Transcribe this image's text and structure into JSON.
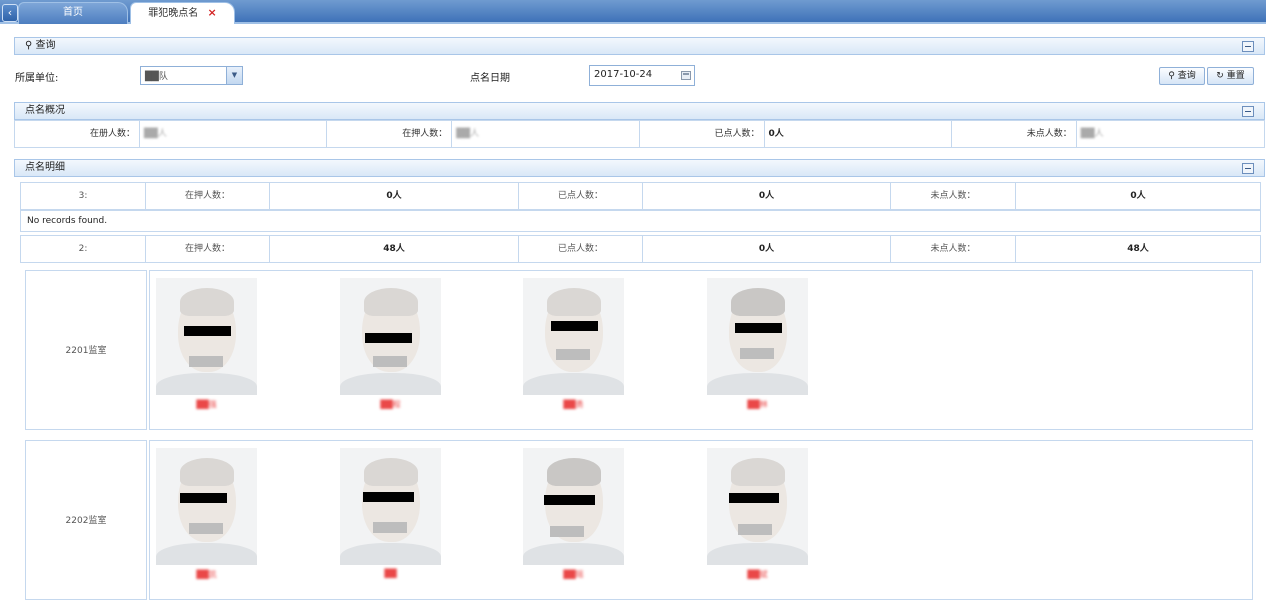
{
  "tabs": {
    "home": "首页",
    "active": "罪犯晚点名",
    "close_glyph": "×",
    "back_glyph": "‹"
  },
  "query": {
    "header": "查询",
    "unit_label": "所属单位:",
    "unit_value": "██队",
    "date_label": "点名日期",
    "date_value": "2017-10-24",
    "search_button": "查询",
    "reset_button": "重置"
  },
  "overview": {
    "header": "点名概况",
    "items": [
      {
        "label": "在册人数：",
        "value": "██人"
      },
      {
        "label": "在押人数：",
        "value": "██人"
      },
      {
        "label": "已点人数：",
        "value": "0人"
      },
      {
        "label": "未点人数：",
        "value": "██人"
      }
    ]
  },
  "detail": {
    "header": "点名明细",
    "groups": [
      {
        "id": "3:",
        "in_custody_label": "在押人数：",
        "in_custody": "0人",
        "called_label": "已点人数：",
        "called": "0人",
        "uncalled_label": "未点人数：",
        "uncalled": "0人"
      },
      {
        "id": "2:",
        "in_custody_label": "在押人数：",
        "in_custody": "48人",
        "called_label": "已点人数：",
        "called": "0人",
        "uncalled_label": "未点人数：",
        "uncalled": "48人"
      }
    ],
    "no_records": "No records found.",
    "rooms": [
      {
        "name": "2201监室",
        "people": [
          "██强",
          "██程",
          "██勇",
          "██林"
        ]
      },
      {
        "name": "2202监室",
        "people": [
          "██凯",
          "██",
          "██瑶",
          "██斌"
        ]
      }
    ]
  },
  "colors": {
    "accent": "#3f72b8",
    "border": "#c5d8ee",
    "name_red": "#ea4848"
  }
}
